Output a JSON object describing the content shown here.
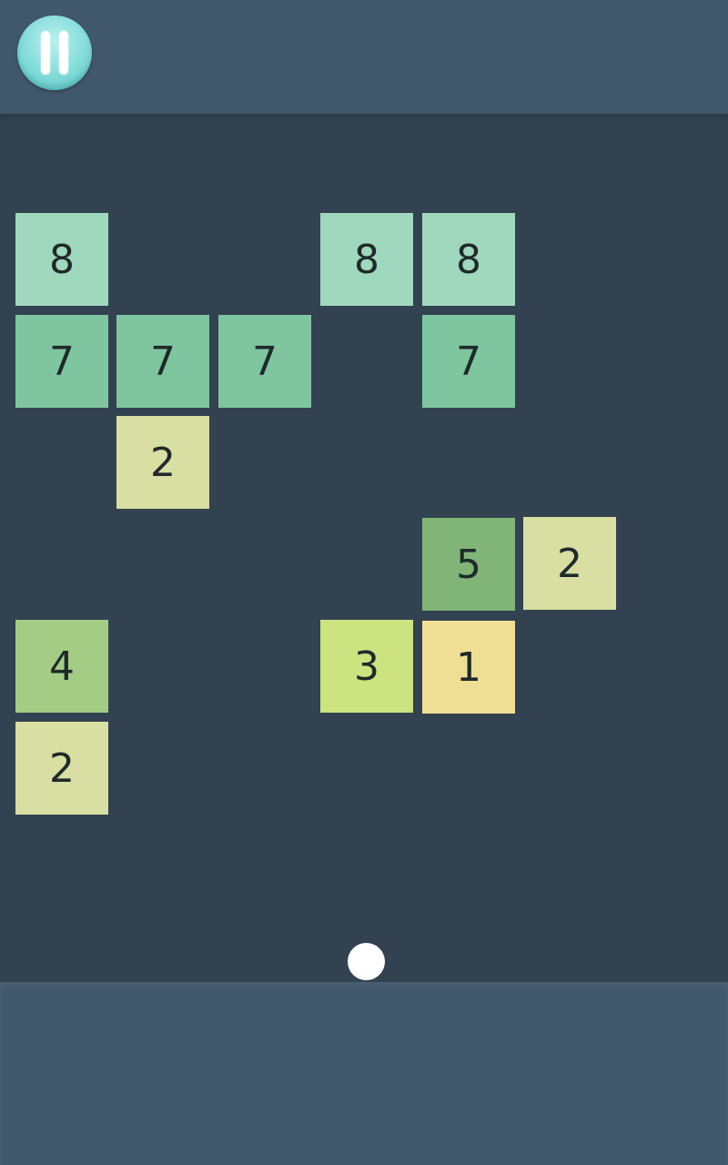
{
  "bricks": [
    {
      "value": "8",
      "color": "#a0d8bd"
    },
    {
      "value": "8",
      "color": "#a0d8bd"
    },
    {
      "value": "8",
      "color": "#a0d8bd"
    },
    {
      "value": "7",
      "color": "#7fc6a0"
    },
    {
      "value": "7",
      "color": "#7fc6a0"
    },
    {
      "value": "7",
      "color": "#7fc6a0"
    },
    {
      "value": "7",
      "color": "#7fc6a0"
    },
    {
      "value": "2",
      "color": "#d9dea2"
    },
    {
      "value": "5",
      "color": "#80b577"
    },
    {
      "value": "2",
      "color": "#d9dea2"
    },
    {
      "value": "4",
      "color": "#a5cc85"
    },
    {
      "value": "3",
      "color": "#cde37f"
    },
    {
      "value": "1",
      "color": "#eedf94"
    },
    {
      "value": "2",
      "color": "#d9dea2"
    }
  ],
  "pause_button": {
    "icon": "pause-icon",
    "color": "#82dcd9"
  },
  "ball": {
    "color": "#ffffff"
  },
  "theme": {
    "background": "#334250",
    "bar": "#41576c"
  }
}
